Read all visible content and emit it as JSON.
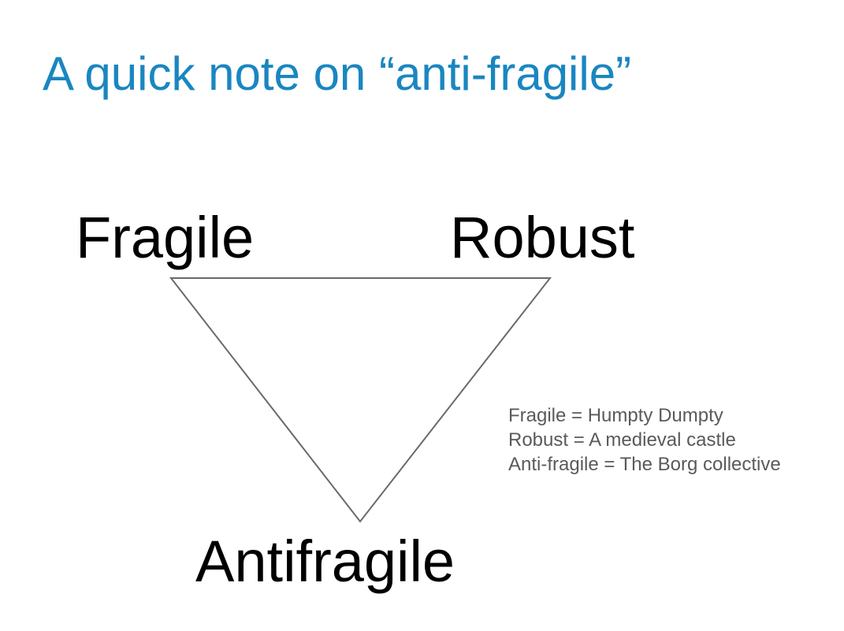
{
  "slide": {
    "title": "A quick note on “anti-fragile”",
    "colors": {
      "title": "#1a86c0",
      "labels": "#000000",
      "triangle_stroke": "#6a6a6a",
      "notes": "#5a5a5a"
    }
  },
  "diagram": {
    "top_left_label": "Fragile",
    "top_right_label": "Robust",
    "bottom_label": "Antifragile"
  },
  "notes": [
    "Fragile = Humpty Dumpty",
    "Robust = A medieval castle",
    "Anti-fragile = The Borg collective"
  ]
}
